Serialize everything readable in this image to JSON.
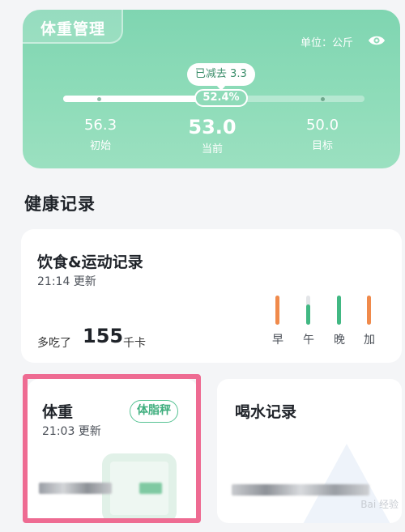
{
  "weight_management": {
    "title": "体重管理",
    "unit_label": "单位：公斤",
    "reduced_label": "已减去 3.3",
    "progress_label": "52.4%",
    "progress_fraction": 0.524,
    "start": {
      "value": "56.3",
      "label": "初始"
    },
    "current": {
      "value": "53.0",
      "label": "当前"
    },
    "target": {
      "value": "50.0",
      "label": "目标"
    }
  },
  "health_records": {
    "section_title": "健康记录",
    "diet": {
      "title": "饮食&运动记录",
      "updated": "21:14 更新",
      "prefix": "多吃了",
      "value": "155",
      "unit": "千卡",
      "meals": [
        {
          "label": "早",
          "fill": 1.0,
          "color": "#f08a4b"
        },
        {
          "label": "午",
          "fill": 0.7,
          "color": "#41b883"
        },
        {
          "label": "晚",
          "fill": 1.0,
          "color": "#41b883"
        },
        {
          "label": "加",
          "fill": 1.0,
          "color": "#f08a4b"
        }
      ]
    },
    "weight": {
      "title": "体重",
      "updated": "21:03 更新",
      "badge": "体脂秤"
    },
    "water": {
      "title": "喝水记录"
    }
  },
  "watermark": "Bai 经验"
}
